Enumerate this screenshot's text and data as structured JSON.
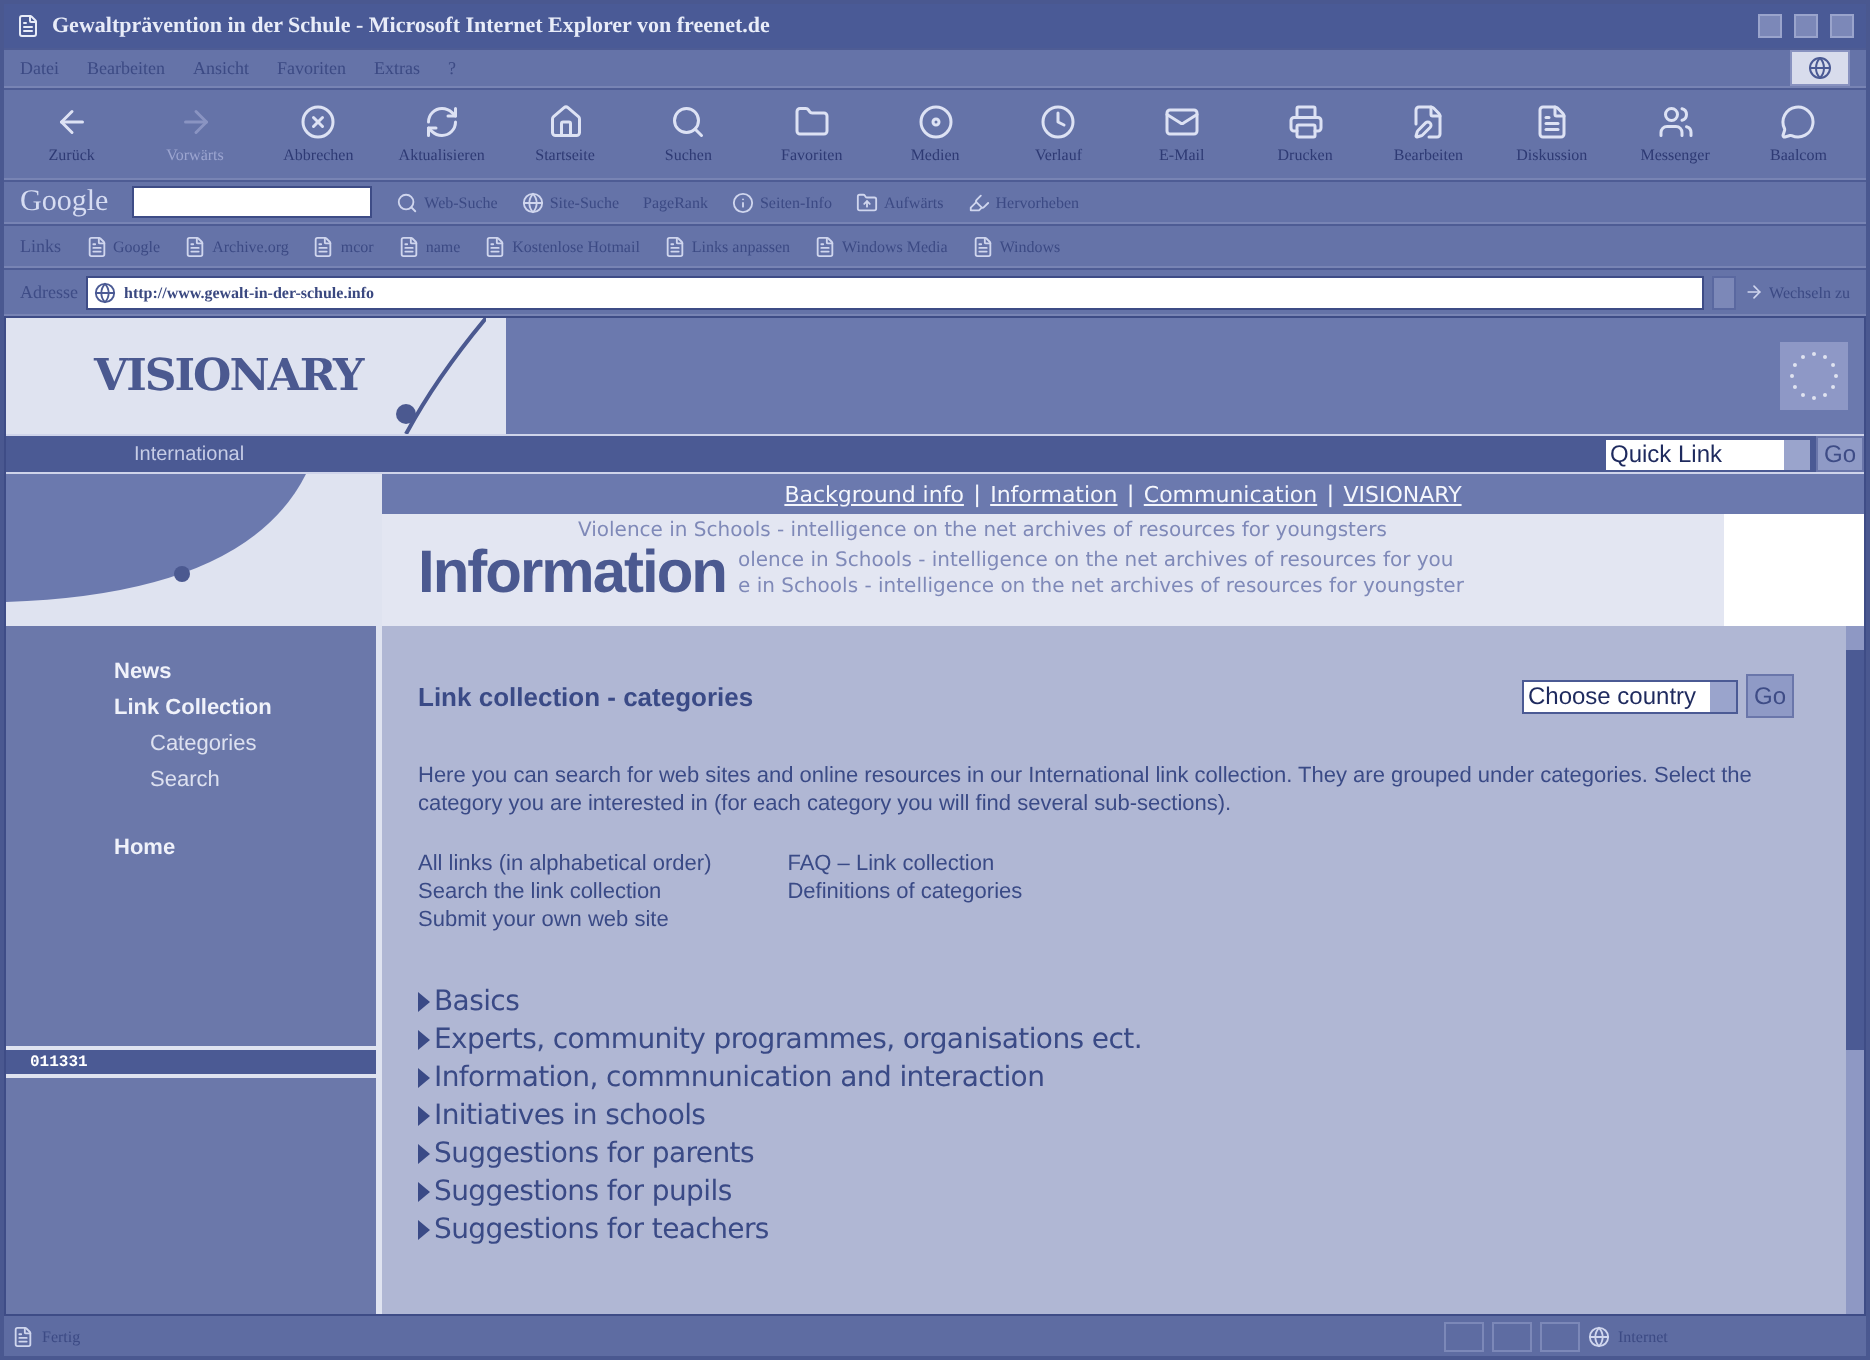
{
  "window": {
    "title": "Gewaltprävention in der Schule - Microsoft Internet Explorer von freenet.de"
  },
  "menu": [
    "Datei",
    "Bearbeiten",
    "Ansicht",
    "Favoriten",
    "Extras",
    "?"
  ],
  "toolbar": [
    {
      "label": "Zurück",
      "kind": "back",
      "disabled": false
    },
    {
      "label": "Vorwärts",
      "kind": "forward",
      "disabled": true
    },
    {
      "label": "Abbrechen",
      "kind": "stop",
      "disabled": false
    },
    {
      "label": "Aktualisieren",
      "kind": "refresh",
      "disabled": false
    },
    {
      "label": "Startseite",
      "kind": "home",
      "disabled": false
    },
    {
      "label": "Suchen",
      "kind": "search",
      "disabled": false
    },
    {
      "label": "Favoriten",
      "kind": "favorites",
      "disabled": false
    },
    {
      "label": "Medien",
      "kind": "media",
      "disabled": false
    },
    {
      "label": "Verlauf",
      "kind": "history",
      "disabled": false
    },
    {
      "label": "E-Mail",
      "kind": "mail",
      "disabled": false
    },
    {
      "label": "Drucken",
      "kind": "print",
      "disabled": false
    },
    {
      "label": "Bearbeiten",
      "kind": "edit",
      "disabled": false
    },
    {
      "label": "Diskussion",
      "kind": "discuss",
      "disabled": false
    },
    {
      "label": "Messenger",
      "kind": "messenger",
      "disabled": false
    },
    {
      "label": "Baalcom",
      "kind": "chat",
      "disabled": false
    }
  ],
  "google_bar": {
    "logo": "Google",
    "buttons": [
      "Web-Suche",
      "Site-Suche",
      "PageRank",
      "Seiten-Info",
      "Aufwärts",
      "Hervorheben"
    ]
  },
  "links_bar": {
    "label": "Links",
    "items": [
      "Google",
      "Archive.org",
      "mcor",
      "name",
      "Kostenlose Hotmail",
      "Links anpassen",
      "Windows Media",
      "Windows"
    ]
  },
  "address_bar": {
    "label": "Adresse",
    "value": "http://www.gewalt-in-der-schule.info",
    "go": "Wechseln zu"
  },
  "page": {
    "logo": "VISIONARY",
    "subtitle": "International",
    "quick_link": {
      "value": "Quick Link",
      "go": "Go"
    },
    "nav": [
      {
        "label": "Background info"
      },
      {
        "separator": "|",
        "label": "Information"
      },
      {
        "separator": "|",
        "label": "Communication"
      },
      {
        "separator": "|",
        "label": "VISIONARY"
      }
    ],
    "banner": {
      "title": "Information",
      "taglines": [
        "Violence in Schools - intelligence on the net archives of resources for youngsters",
        "olence in Schools - intelligence on the net archives of resources for you",
        "e in Schools - intelligence on the net archives of resources for youngster"
      ]
    },
    "sidebar": {
      "items": [
        {
          "label": "News"
        },
        {
          "label": "Link Collection",
          "children": [
            {
              "label": "Categories"
            },
            {
              "label": "Search"
            }
          ]
        },
        {
          "label": "Home"
        }
      ],
      "counter": "011331"
    },
    "content": {
      "heading": "Link collection - categories",
      "country_select": {
        "value": "Choose country",
        "go": "Go"
      },
      "intro": "Here you can search for web sites and online resources in our International link collection. They are grouped under categories. Select the category you are interested in (for each category you will find several sub-sections).",
      "link_columns": [
        [
          "All links (in alphabetical order)",
          "Search the link collection",
          "Submit your own web site"
        ],
        [
          "FAQ – Link collection",
          "Definitions of categories"
        ]
      ],
      "categories": [
        "Basics",
        "Experts, community programmes, organisations ect.",
        "Information, commnunication and interaction",
        "Initiatives in schools",
        "Suggestions for parents",
        "Suggestions for pupils",
        "Suggestions for teachers"
      ]
    }
  },
  "status_bar": {
    "text": "Fertig",
    "zone": "Internet"
  }
}
